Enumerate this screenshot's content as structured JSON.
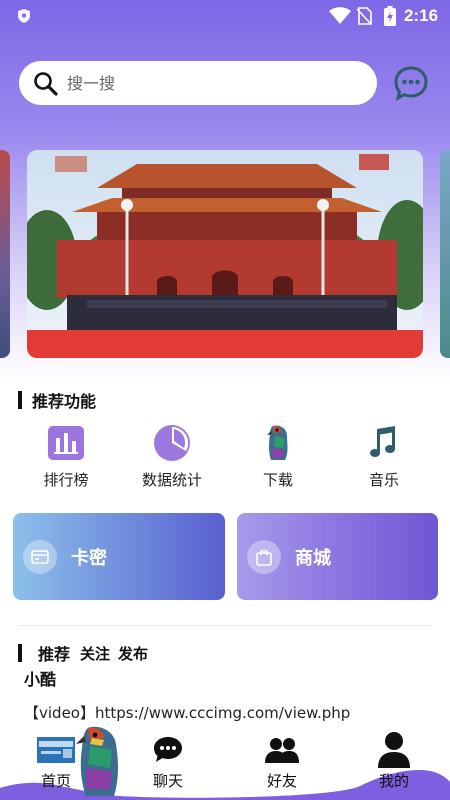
{
  "status_bar": {
    "time": "2:16"
  },
  "search": {
    "placeholder": "搜一搜"
  },
  "section": {
    "title": "推荐功能"
  },
  "features": [
    {
      "label": "排行榜",
      "icon": "bar-chart-icon"
    },
    {
      "label": "数据统计",
      "icon": "pie-chart-icon"
    },
    {
      "label": "下载",
      "icon": "parrot-icon"
    },
    {
      "label": "音乐",
      "icon": "music-note-icon"
    }
  ],
  "cards": [
    {
      "label": "卡密",
      "icon": "card-icon"
    },
    {
      "label": "商城",
      "icon": "shopping-bag-icon"
    }
  ],
  "tabs": [
    "推荐",
    "关注",
    "发布"
  ],
  "post": {
    "author": "小酷",
    "text": "【video】https://www.cccimg.com/view.php"
  },
  "nav": [
    {
      "label": "首页",
      "icon": "home-icon"
    },
    {
      "label": "聊天",
      "icon": "chat-icon"
    },
    {
      "label": "好友",
      "icon": "friends-icon"
    },
    {
      "label": "我的",
      "icon": "profile-icon"
    }
  ],
  "colors": {
    "accent": "#7d67e6",
    "icon_teal": "#2f5d6b"
  }
}
